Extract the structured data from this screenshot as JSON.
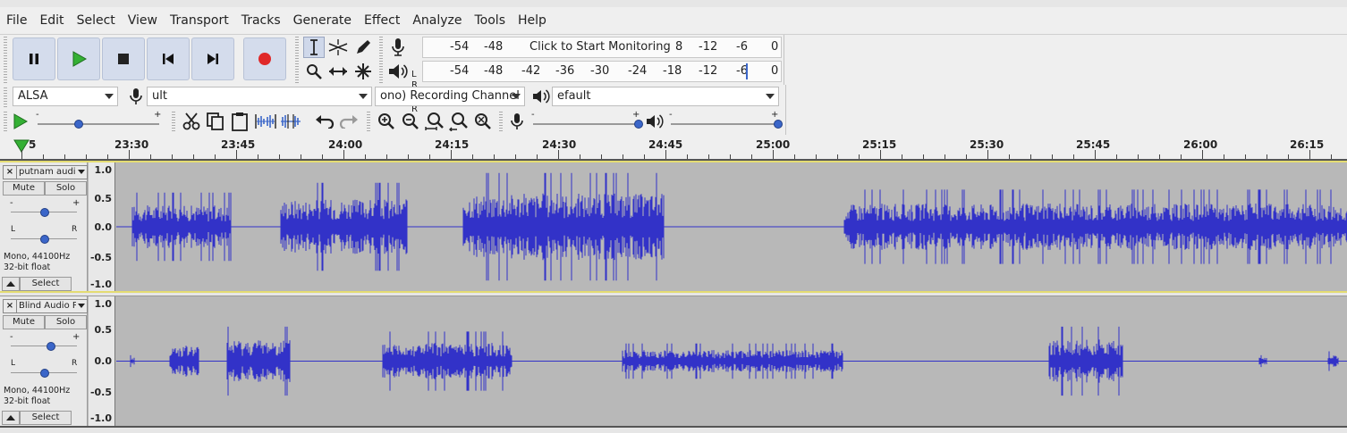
{
  "menu": [
    "File",
    "Edit",
    "Select",
    "View",
    "Transport",
    "Tracks",
    "Generate",
    "Effect",
    "Analyze",
    "Tools",
    "Help"
  ],
  "icons": {
    "pause": "pause-icon",
    "play": "play-icon",
    "stop": "stop-icon",
    "skip_start": "skip-to-start-icon",
    "skip_end": "skip-to-end-icon",
    "record": "record-icon",
    "select_tool": "i-beam-icon",
    "envelope_tool": "envelope-icon",
    "draw_tool": "pencil-icon",
    "zoom_tool": "magnifier-icon",
    "timeshift_tool": "time-shift-icon",
    "multi_tool": "multi-tool-icon",
    "mic": "microphone-icon",
    "speaker": "speaker-icon",
    "cut": "scissors-icon",
    "copy": "copy-icon",
    "paste": "paste-icon",
    "trim": "trim-icon",
    "silence": "silence-icon",
    "undo": "undo-icon",
    "redo": "redo-icon",
    "zoom_in": "zoom-in-icon",
    "zoom_out": "zoom-out-icon",
    "fit_selection": "fit-selection-icon",
    "fit_project": "fit-project-icon",
    "zoom_toggle": "zoom-toggle-icon"
  },
  "colors": {
    "record": "#d62a2a",
    "play": "#2a9a2a",
    "waveform": "#3232c8",
    "accent": "#3b66c9"
  },
  "meters": {
    "record_labels": [
      "-54",
      "-48",
      "Click to Start Monitoring",
      "8",
      "-12",
      "-6",
      "0"
    ],
    "playback_labels": [
      "-54",
      "-48",
      "-42",
      "-36",
      "-30",
      "-24",
      "-18",
      "-12",
      "-6",
      "0"
    ],
    "channel_labels": [
      "L",
      "R"
    ]
  },
  "devices": {
    "host": "ALSA",
    "recording_device": "ult",
    "channels": "ono) Recording Channel",
    "playback_device": "efault"
  },
  "timeline": {
    "start_partial": "5",
    "ticks": [
      "23:30",
      "23:45",
      "24:00",
      "24:15",
      "24:30",
      "24:45",
      "25:00",
      "25:15",
      "25:30",
      "25:45",
      "26:00",
      "26:15"
    ]
  },
  "tracks": [
    {
      "name": "putnam audi",
      "mute": "Mute",
      "solo": "Solo",
      "gain_labels": [
        "-",
        "+"
      ],
      "pan_labels": [
        "L",
        "R"
      ],
      "format_line1": "Mono, 44100Hz",
      "format_line2": "32-bit float",
      "select": "Select",
      "scale": [
        "1.0",
        "0.5",
        "0.0",
        "-0.5",
        "-1.0"
      ]
    },
    {
      "name": "Blind Audio P",
      "mute": "Mute",
      "solo": "Solo",
      "gain_labels": [
        "-",
        "+"
      ],
      "pan_labels": [
        "L",
        "R"
      ],
      "format_line1": "Mono, 44100Hz",
      "format_line2": "32-bit float",
      "select": "Select",
      "scale": [
        "1.0",
        "0.5",
        "0.0",
        "-0.5",
        "-1.0"
      ]
    }
  ]
}
